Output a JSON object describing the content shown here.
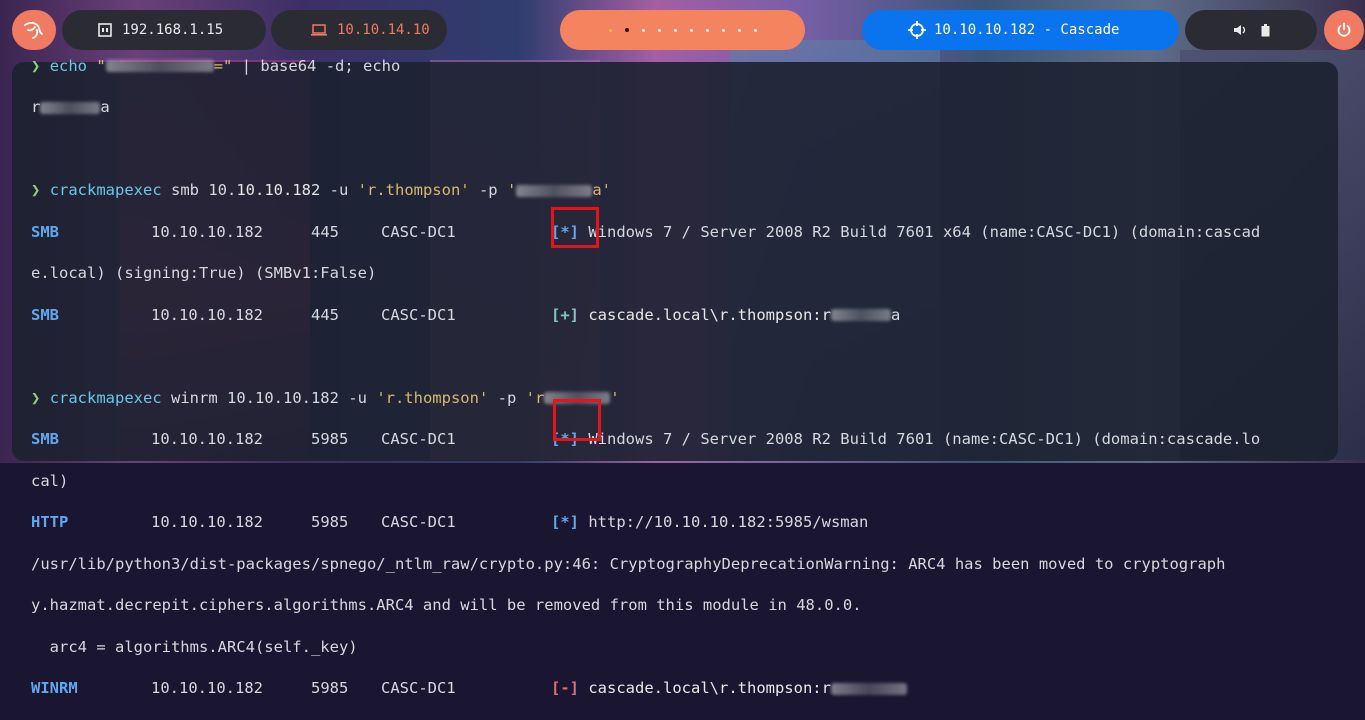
{
  "topbar": {
    "local_ip": "192.168.1.15",
    "vpn_ip": "10.10.14.10",
    "workspaces": [
      {
        "active": false
      },
      {
        "active": true
      },
      {
        "active": false
      },
      {
        "active": false
      },
      {
        "active": false
      },
      {
        "active": false
      },
      {
        "active": false
      },
      {
        "active": false
      },
      {
        "active": false
      },
      {
        "active": false
      }
    ],
    "target": "10.10.10.182 - Cascade",
    "accent": "#f07a62",
    "target_color": "#0a74ef"
  },
  "terminal": {
    "prompt": "❯",
    "cmd1": {
      "prog": "echo",
      "quote_open": "\"",
      "quote_close": "=\"",
      "rest": " | base64 -d; echo",
      "output_prefix": "r",
      "output_suffix": "a"
    },
    "cmd2": {
      "prog": "crackmapexec",
      "args_plain": " smb 10.",
      "args_highlight": "10.10.182",
      "args_rest": " -u ",
      "user": "'r.thompson'",
      "flag": " -p ",
      "pw_open": "'",
      "pw_close": "a'"
    },
    "smb_rows": [
      {
        "proto": "SMB",
        "ip": "10.10.10.182",
        "port": "445",
        "host": "CASC-DC1",
        "status": "[*]",
        "msg": "Windows 7 / Server 2008 R2 Build 7601 x64 (name:CASC-DC1) (domain:cascad"
      },
      {
        "continuation": "e.local) (signing:True) (SMBv1:False)"
      },
      {
        "proto": "SMB",
        "ip": "10.10.10.182",
        "port": "445",
        "host": "CASC-DC1",
        "status": "[+]",
        "msg": "cascade.local\\r.thompson:r",
        "msg_tail": "a"
      }
    ],
    "cmd3": {
      "prog": "crackmapexec",
      "args": " winrm 10.10.10.182 -u ",
      "user": "'r.thompson'",
      "flag": " -p ",
      "pw_open": "'r",
      "pw_close": "'"
    },
    "winrm_rows": [
      {
        "proto": "SMB",
        "ip": "10.10.10.182",
        "port": "5985",
        "host": "CASC-DC1",
        "status": "[*]",
        "msg": "Windows 7 / Server 2008 R2 Build 7601 (name:CASC-DC1) (domain:cascade.lo"
      },
      {
        "continuation": "cal)"
      },
      {
        "proto": "HTTP",
        "ip": "10.10.10.182",
        "port": "5985",
        "host": "CASC-DC1",
        "status": "[*]",
        "msg": "http://10.10.10.182:5985/wsman"
      },
      {
        "continuation": "/usr/lib/python3/dist-packages/spnego/_ntlm_raw/crypto.py:46: CryptographyDeprecationWarning: ARC4 has been moved to cryptograph"
      },
      {
        "continuation": "y.hazmat.decrepit.ciphers.algorithms.ARC4 and will be removed from this module in 48.0.0."
      },
      {
        "continuation": "  arc4 = algorithms.ARC4(self._key)"
      },
      {
        "proto": "WINRM",
        "ip": "10.10.10.182",
        "port": "5985",
        "host": "CASC-DC1",
        "status": "[-]",
        "msg": "cascade.local\\r.thompson:r"
      }
    ]
  }
}
